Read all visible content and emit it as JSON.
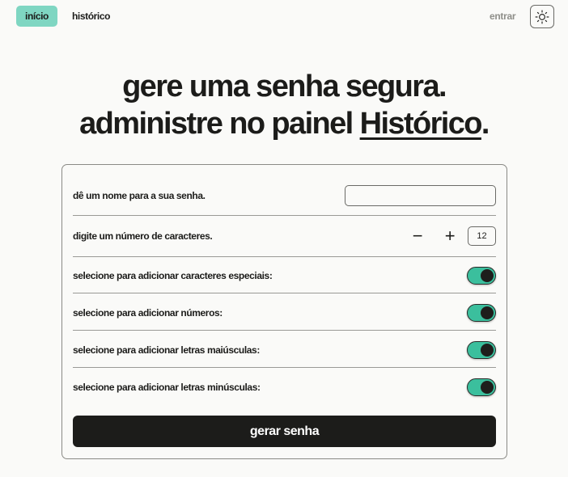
{
  "nav": {
    "home_label": "início",
    "history_label": "histórico",
    "login_label": "entrar",
    "theme_icon": "sun-icon"
  },
  "hero": {
    "line1": "gere uma senha segura.",
    "line2_prefix": "administre no painel ",
    "line2_link": "Histórico",
    "line2_suffix": "."
  },
  "form": {
    "name_label": "dê um nome para a sua senha.",
    "name_value": "",
    "length_label": "digite um número de caracteres.",
    "length_value": "12",
    "minus_symbol": "−",
    "plus_symbol": "+",
    "toggles": [
      {
        "label": "selecione para adicionar caracteres especiais:",
        "enabled": true
      },
      {
        "label": "selecione para adicionar números:",
        "enabled": true
      },
      {
        "label": "selecione para adicionar letras maiúsculas:",
        "enabled": true
      },
      {
        "label": "selecione para adicionar letras minúsculas:",
        "enabled": true
      }
    ],
    "submit_label": "gerar senha"
  },
  "colors": {
    "accent": "#7fd6c2",
    "toggle_on": "#3bbf9d",
    "dark": "#1c1c1a",
    "background": "#fafaf8"
  }
}
